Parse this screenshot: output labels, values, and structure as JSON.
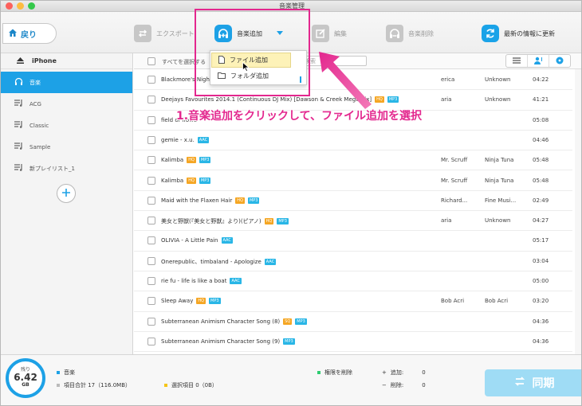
{
  "window": {
    "title": "音楽管理",
    "lights": [
      "#fc605c",
      "#fdbc40",
      "#34c84a"
    ]
  },
  "toolbar": {
    "back_label": "戻り",
    "export_label": "エクスポート",
    "add_music_label": "音楽追加",
    "edit_label": "編集",
    "delete_label": "音楽削除",
    "refresh_label": "最新の情報に更新"
  },
  "dropdown": {
    "add_file_label": "ファイル追加",
    "add_folder_label": "フォルダ追加"
  },
  "sidebar": {
    "device": "iPhone",
    "items": [
      {
        "label": "音楽"
      },
      {
        "label": "ACG"
      },
      {
        "label": "Classic"
      },
      {
        "label": "Sample"
      },
      {
        "label": "新プレイリスト_1"
      }
    ]
  },
  "list": {
    "select_all_label": "すべてを選択する",
    "search_placeholder": "検索",
    "rows": [
      {
        "name": "Blackmore's Night -",
        "badges": [],
        "artist": "erica",
        "album": "Unknown",
        "duration": "04:22"
      },
      {
        "name": "Deejays Favourites 2014.1 (Continuous DJ Mix) [Dawson & Creek Megamix]",
        "badges": [
          "HQ",
          "MP3"
        ],
        "artist": "aria",
        "album": "Unknown",
        "duration": "41:21"
      },
      {
        "name": "field of flowe",
        "badges": [],
        "artist": "",
        "album": "",
        "duration": "05:08"
      },
      {
        "name": "gemie - x.u.",
        "badges": [
          "AAC"
        ],
        "artist": "",
        "album": "",
        "duration": "04:46"
      },
      {
        "name": "Kalimba",
        "badges": [
          "HQ",
          "MP3"
        ],
        "artist": "Mr. Scruff",
        "album": "Ninja Tuna",
        "duration": "05:48"
      },
      {
        "name": "Kalimba",
        "badges": [
          "HQ",
          "MP3"
        ],
        "artist": "Mr. Scruff",
        "album": "Ninja Tuna",
        "duration": "05:48"
      },
      {
        "name": "Maid with the Flaxen Hair",
        "badges": [
          "HQ",
          "MP3"
        ],
        "artist": "Richard...",
        "album": "Fine Musi...",
        "duration": "02:49"
      },
      {
        "name": "美女と野獣(『美女と野獣』より)(ピアノ)",
        "badges": [
          "HQ",
          "MP3"
        ],
        "artist": "aria",
        "album": "Unknown",
        "duration": "04:27"
      },
      {
        "name": "OLIVIA - A Little Pain",
        "badges": [
          "AAC"
        ],
        "artist": "",
        "album": "",
        "duration": "05:17"
      },
      {
        "name": "Onerepublic、timbaland - Apologize",
        "badges": [
          "AAC"
        ],
        "artist": "",
        "album": "",
        "duration": "03:04"
      },
      {
        "name": "rie fu - life is like a boat",
        "badges": [
          "AAC"
        ],
        "artist": "",
        "album": "",
        "duration": "05:00"
      },
      {
        "name": "Sleep Away",
        "badges": [
          "HQ",
          "MP3"
        ],
        "artist": "Bob Acri",
        "album": "Bob Acri",
        "duration": "03:20"
      },
      {
        "name": "Subterranean Animism Character Song (8)",
        "badges": [
          "SQ",
          "MP3"
        ],
        "artist": "",
        "album": "",
        "duration": "04:36"
      },
      {
        "name": "Subterranean Animism Character Song (9)",
        "badges": [
          "MP3"
        ],
        "artist": "",
        "album": "",
        "duration": "04:36"
      }
    ]
  },
  "annotation": "1.音楽追加をクリックして、ファイル追加を選択",
  "footer": {
    "storage_label": "残り",
    "storage_value": "6.42",
    "storage_unit": "GB",
    "category_label": "音楽",
    "total_label": "項目合計 17（116.0MB）",
    "selected_label": "選択項目 0（0B）",
    "delete_permission_label": "権限を削除",
    "add_label": "追加:",
    "add_value": "0",
    "remove_label": "削除:",
    "remove_value": "0",
    "sync_label": "同期"
  },
  "colors": {
    "accent": "#1da1e6",
    "highlight": "#e3278e",
    "hq_badge": "#f5a623",
    "format_badge": "#29b6e6",
    "sync_button": "#9fdcf5"
  }
}
